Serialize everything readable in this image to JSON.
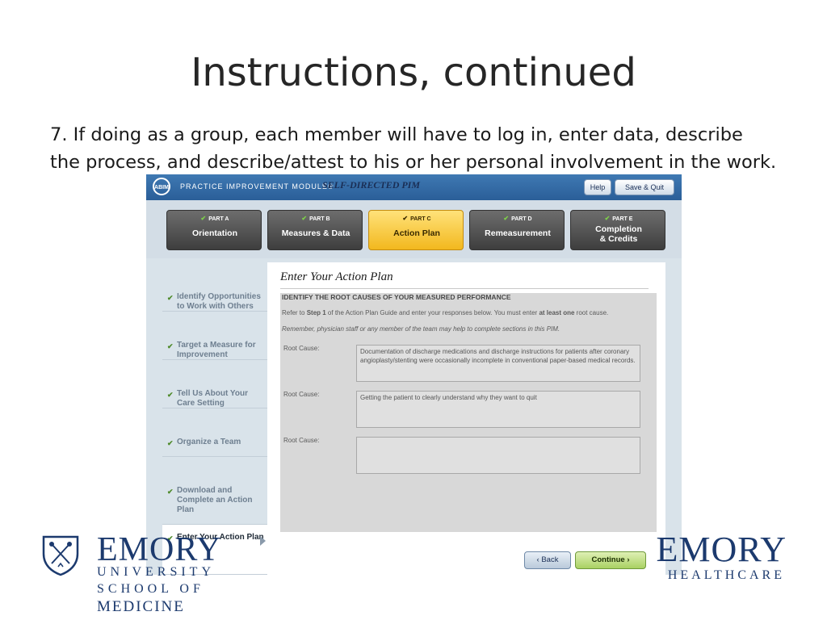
{
  "slide": {
    "title": "Instructions, continued",
    "body": "7.  If doing as a group, each member will have to log in, enter data, describe the process, and describe/attest to his or her personal involvement in the work."
  },
  "footer": {
    "left_logo": {
      "word": "EMORY",
      "line1": "UNIVERSITY",
      "line2": "SCHOOL OF",
      "line3": "MEDICINE"
    },
    "right_logo": {
      "word": "EMORY",
      "line1": "HEALTHCARE"
    },
    "colors": {
      "emory_blue": "#1c3a6e"
    }
  },
  "app": {
    "header": {
      "logo_text": "ABIM",
      "module_name": "PRACTICE IMPROVEMENT MODULE®",
      "pim_name": "SELF-DIRECTED PIM",
      "help_label": "Help",
      "save_label": "Save & Quit"
    },
    "parts": [
      {
        "label": "PART A",
        "name": "Orientation"
      },
      {
        "label": "PART B",
        "name": "Measures & Data"
      },
      {
        "label": "PART C",
        "name": "Action Plan"
      },
      {
        "label": "PART D",
        "name": "Remeasurement"
      },
      {
        "label": "PART E",
        "name_line1": "Completion",
        "name_line2": "& Credits"
      }
    ],
    "check_glyph": "✔",
    "steps": [
      "Identify Opportunities to Work with Others",
      "Target a Measure for Improvement",
      "Tell Us About Your Care Setting",
      "Organize a Team",
      "Download and Complete an Action Plan",
      "Enter Your Action Plan"
    ],
    "main": {
      "title": "Enter Your Action Plan",
      "section_heading": "IDENTIFY THE ROOT CAUSES OF YOUR MEASURED PERFORMANCE",
      "instruction_prefix": "Refer to ",
      "instruction_bold1": "Step 1",
      "instruction_mid": " of the Action Plan Guide and enter your responses below. You must enter ",
      "instruction_bold2": "at least one",
      "instruction_suffix": " root cause.",
      "note": "Remember, physician staff or any member of the team may help to complete sections in this PIM.",
      "root_cause_label": "Root Cause:",
      "root_causes": [
        "Documentation of discharge medications and discharge instructions for patients after coronary angioplasty/stenting were occasionally incomplete in conventional paper-based medical records.",
        "Getting the patient to clearly understand why they want to quit",
        ""
      ],
      "back_label": "‹ Back",
      "continue_label": "Continue ›"
    },
    "colors": {
      "active_part": "#f2b81e",
      "header_blue": "#2a5e98",
      "check_green": "#4e8a2a"
    }
  }
}
